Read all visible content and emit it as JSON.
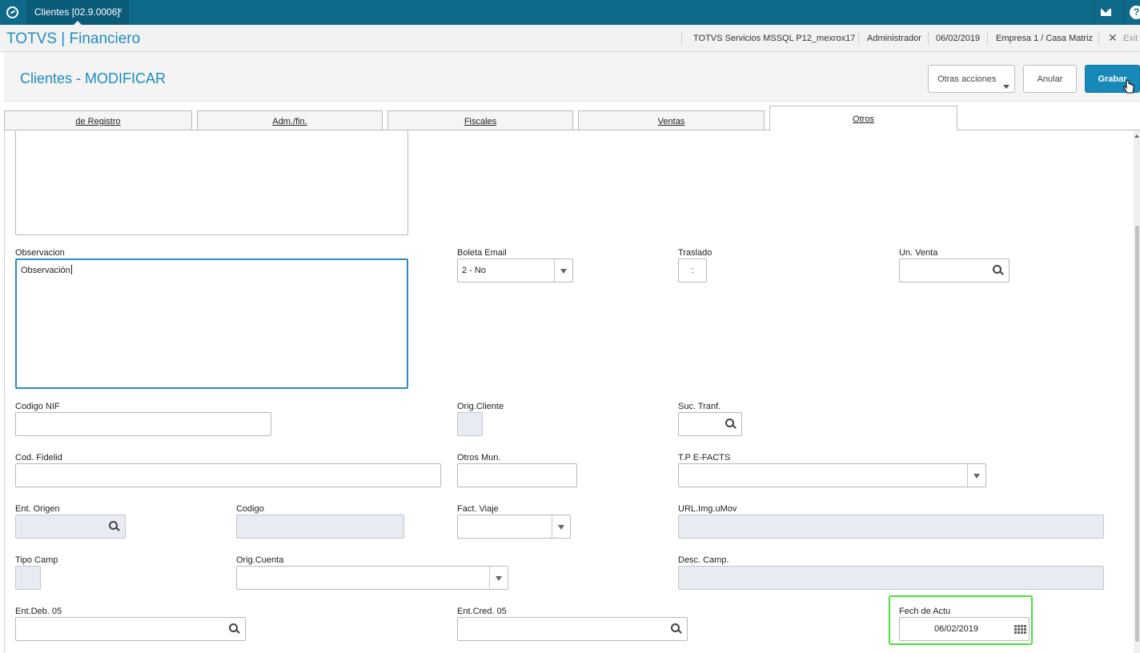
{
  "topbar": {
    "tab_title": "Clientes [02.9.0006]",
    "tab_close": "×"
  },
  "header": {
    "brand": "TOTVS | Financiero",
    "environment": "TOTVS Servicios MSSQL P12_mexrox17",
    "user": "Administrador",
    "date": "06/02/2019",
    "company": "Empresa 1 / Casa Matriz",
    "exit_label": "Exit"
  },
  "titlebar": {
    "title": "Clientes - MODIFICAR",
    "more_actions_label": "Otras acciones",
    "cancel_label": "Anular",
    "save_label": "Grabar"
  },
  "tabs": [
    {
      "label": "de Registro",
      "active": false
    },
    {
      "label": "Adm./fin.",
      "active": false
    },
    {
      "label": "Fiscales",
      "active": false
    },
    {
      "label": "Ventas",
      "active": false
    },
    {
      "label": "Otros",
      "active": true
    }
  ],
  "form": {
    "observacion": {
      "label": "Observacion",
      "value": "Observación"
    },
    "boleta_email": {
      "label": "Boleta Email",
      "value": "2 - No"
    },
    "traslado": {
      "label": "Traslado",
      "value": ":"
    },
    "un_venta": {
      "label": "Un. Venta",
      "value": ""
    },
    "codigo_nif": {
      "label": "Codigo NIF",
      "value": ""
    },
    "orig_cliente": {
      "label": "Orig.Cliente",
      "value": ""
    },
    "suc_tranf": {
      "label": "Suc. Tranf.",
      "value": ""
    },
    "cod_fidelid": {
      "label": "Cod. Fidelid",
      "value": ""
    },
    "otros_mun": {
      "label": "Otros Mun.",
      "value": ""
    },
    "tpe_facts": {
      "label": "T.P E-FACTS",
      "value": ""
    },
    "ent_origen": {
      "label": "Ent. Origen",
      "value": ""
    },
    "codigo": {
      "label": "Codigo",
      "value": ""
    },
    "fact_viaje": {
      "label": "Fact. Viaje",
      "value": ""
    },
    "url_img": {
      "label": "URL.Img.uMov",
      "value": ""
    },
    "tipo_camp": {
      "label": "Tipo Camp",
      "value": ""
    },
    "orig_cuenta": {
      "label": "Orig.Cuenta",
      "value": ""
    },
    "desc_camp": {
      "label": "Desc. Camp.",
      "value": ""
    },
    "ent_deb": {
      "label": "Ent.Deb. 05",
      "value": ""
    },
    "ent_cred": {
      "label": "Ent.Cred. 05",
      "value": ""
    },
    "fech_actu": {
      "label": "Fech de Actu",
      "value": "06/02/2019"
    }
  },
  "colors": {
    "topbar": "#0f6a8a",
    "brand": "#1f8dbf",
    "save_button": "#1689b8",
    "focus_border": "#2d8ac4",
    "highlight": "#4be03a"
  }
}
